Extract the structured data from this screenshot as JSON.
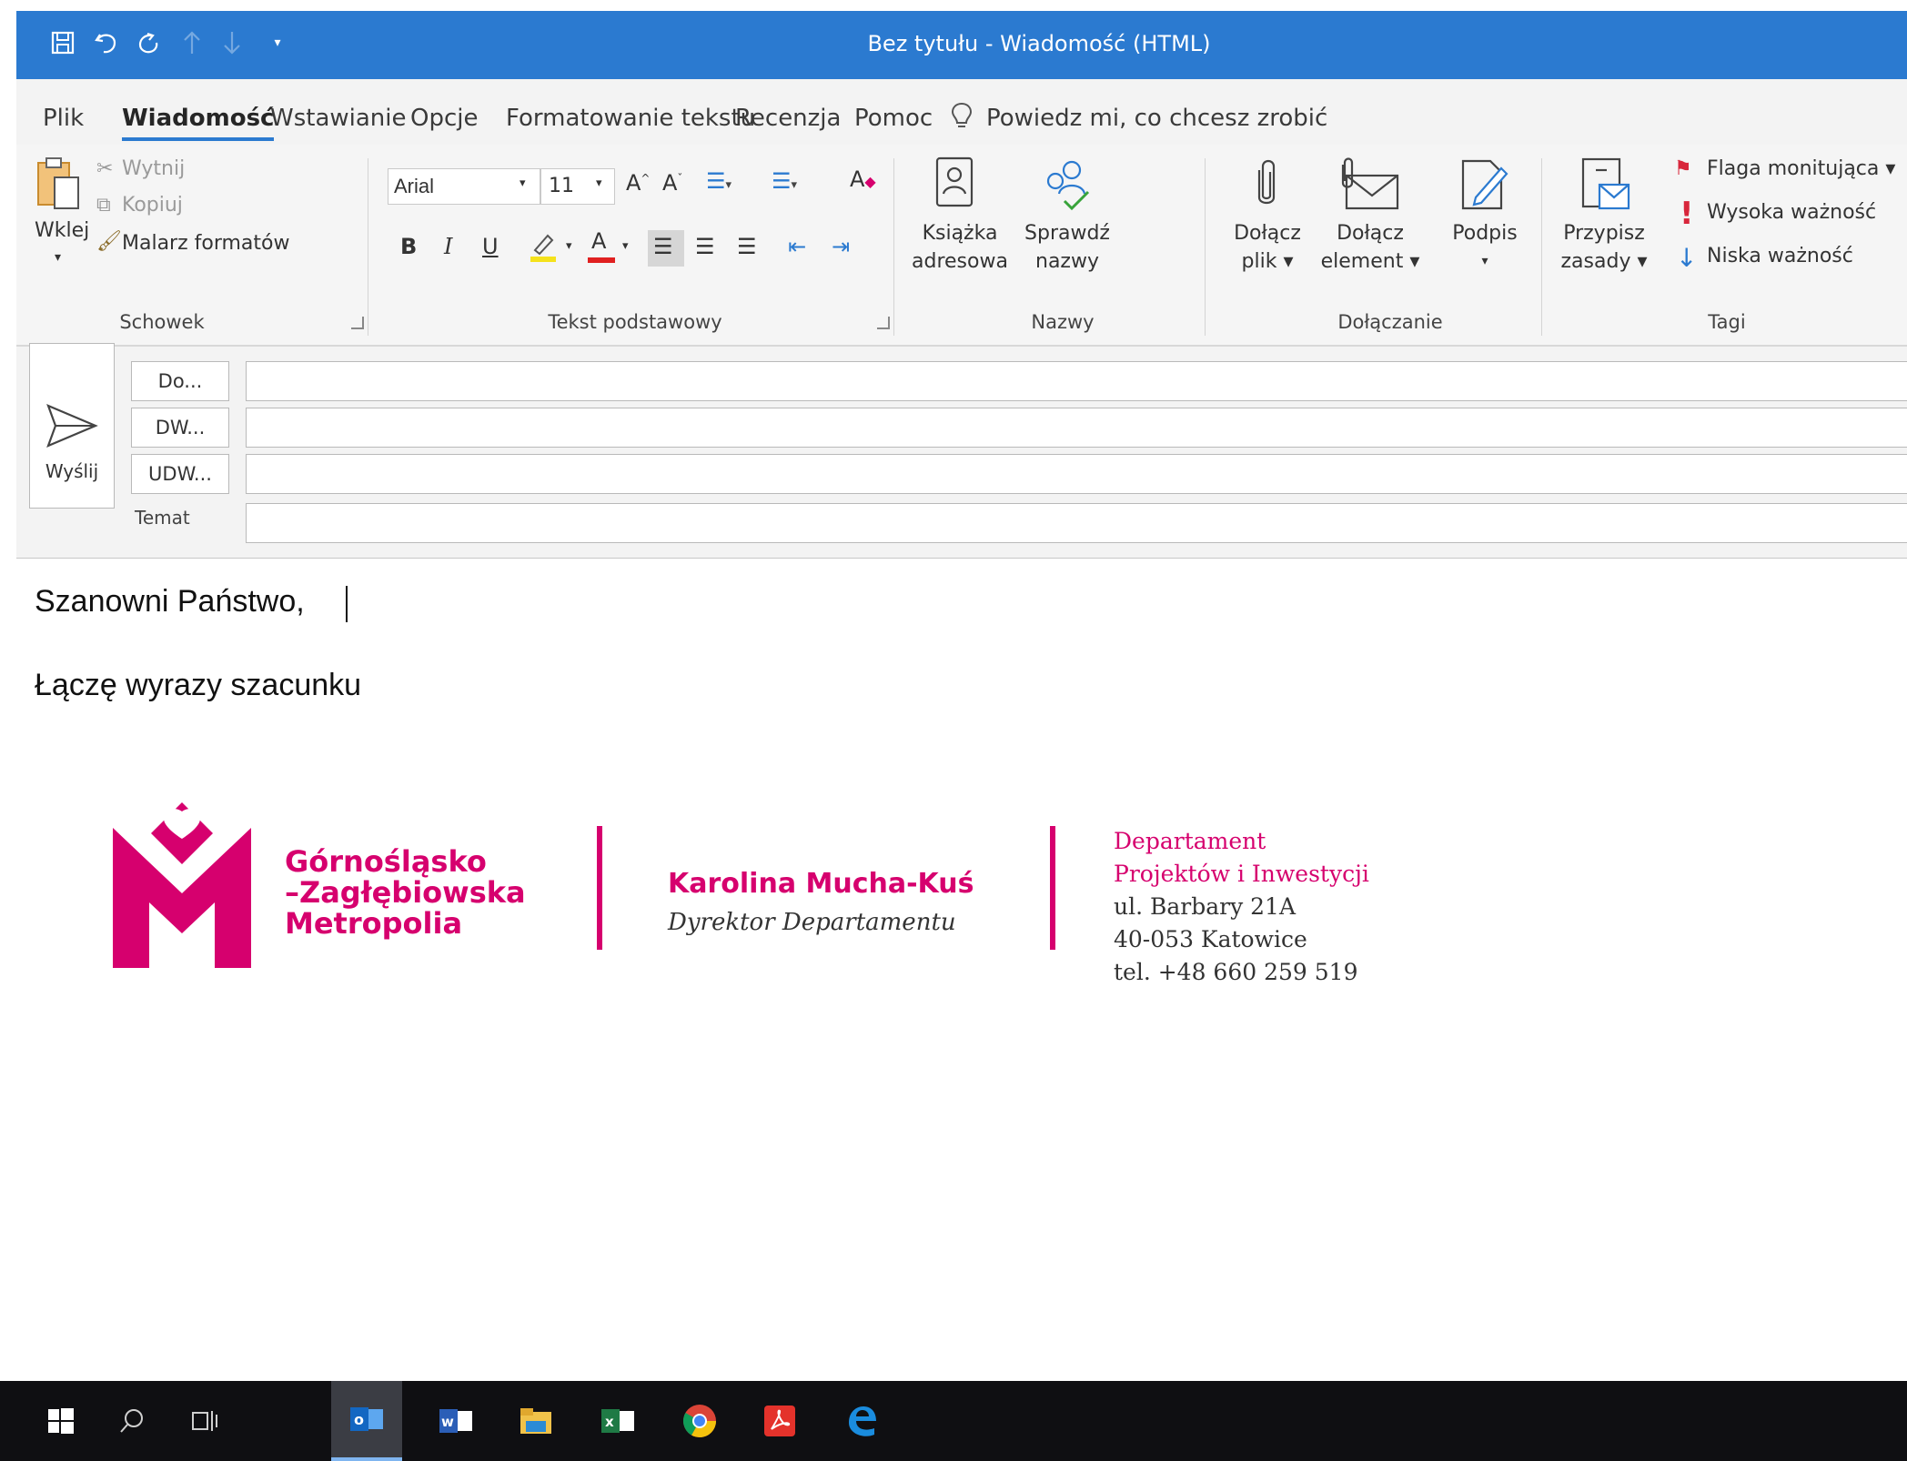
{
  "window": {
    "title": "Bez tytułu  -  Wiadomość (HTML)"
  },
  "tabs": [
    {
      "label": "Plik"
    },
    {
      "label": "Wiadomość"
    },
    {
      "label": "Wstawianie"
    },
    {
      "label": "Opcje"
    },
    {
      "label": "Formatowanie tekstu"
    },
    {
      "label": "Recenzja"
    },
    {
      "label": "Pomoc"
    }
  ],
  "tell_me": "Powiedz mi, co chcesz zrobić",
  "ribbon": {
    "clipboard": {
      "paste": "Wklej",
      "cut": "Wytnij",
      "copy": "Kopiuj",
      "painter": "Malarz formatów",
      "group": "Schowek"
    },
    "basic_text": {
      "font": "Arial",
      "size": "11",
      "group": "Tekst podstawowy"
    },
    "names": {
      "address_book_1": "Książka",
      "address_book_2": "adresowa",
      "check_names_1": "Sprawdź",
      "check_names_2": "nazwy",
      "group": "Nazwy"
    },
    "include": {
      "attach_file_1": "Dołącz",
      "attach_file_2": "plik ▾",
      "attach_item_1": "Dołącz",
      "attach_item_2": "element ▾",
      "signature": "Podpis",
      "group": "Dołączanie"
    },
    "tags": {
      "assign_1": "Przypisz",
      "assign_2": "zasady ▾",
      "follow_up": "Flaga monitująca ▾",
      "high": "Wysoka ważność",
      "low": "Niska ważność",
      "group": "Tagi"
    }
  },
  "compose": {
    "send": "Wyślij",
    "to": "Do...",
    "cc": "DW...",
    "bcc": "UDW...",
    "subject_label": "Temat",
    "to_value": "",
    "cc_value": "",
    "bcc_value": "",
    "subject_value": ""
  },
  "body": {
    "greeting": "Szanowni Państwo,",
    "closing": "Łączę wyrazy szacunku"
  },
  "signature": {
    "org_line1": "Górnośląsko",
    "org_line2": "–Zagłębiowska",
    "org_line3": "Metropolia",
    "name": "Karolina Mucha-Kuś",
    "role": "Dyrektor Departamentu",
    "dept_line1": "Departament",
    "dept_line2": "Projektów i Inwestycji",
    "street": "ul. Barbary 21A",
    "city": "40-053 Katowice",
    "phone": "tel. +48 660 259 519",
    "brand_color": "#d6006e"
  },
  "taskbar": {
    "items": [
      "windows-start-icon",
      "search-icon",
      "task-view-icon",
      "outlook-icon",
      "word-icon",
      "file-explorer-icon",
      "excel-icon",
      "chrome-icon",
      "acrobat-icon",
      "edge-icon"
    ]
  },
  "colors": {
    "accent": "#2b7ad0",
    "brand": "#d6006e",
    "taskbar": "#0f0f12"
  }
}
